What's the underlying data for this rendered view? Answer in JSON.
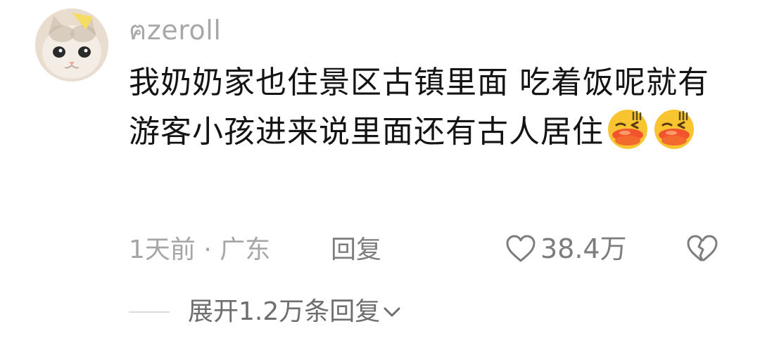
{
  "comment": {
    "avatar_icon": "cat-avatar",
    "username": "ฅzeroll",
    "text": "我奶奶家也住景区古镇里面 吃着饭呢就有游客小孩进来说里面还有古人居住",
    "emojis": [
      "duck-lips-emoji",
      "duck-lips-emoji"
    ],
    "time_location": "1天前 · 广东",
    "reply_label": "回复",
    "like_icon": "heart-outline-icon",
    "like_count": "38.4万",
    "dislike_icon": "broken-heart-icon"
  },
  "replies": {
    "expand_label": "展开1.2万条回复",
    "chevron_icon": "chevron-down-icon"
  }
}
